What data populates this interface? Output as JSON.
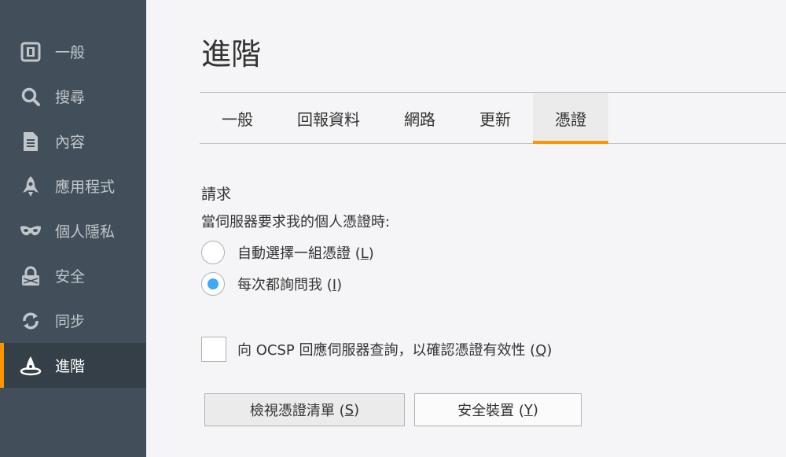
{
  "sidebar": {
    "items": [
      {
        "label": "一般",
        "icon": "general-icon"
      },
      {
        "label": "搜尋",
        "icon": "search-icon"
      },
      {
        "label": "內容",
        "icon": "document-icon"
      },
      {
        "label": "應用程式",
        "icon": "rocket-icon"
      },
      {
        "label": "個人隱私",
        "icon": "mask-icon"
      },
      {
        "label": "安全",
        "icon": "lock-icon"
      },
      {
        "label": "同步",
        "icon": "sync-icon"
      },
      {
        "label": "進階",
        "icon": "wizard-hat-icon"
      }
    ],
    "selected_index": 7
  },
  "page": {
    "title": "進階"
  },
  "tabs": [
    {
      "label": "一般"
    },
    {
      "label": "回報資料"
    },
    {
      "label": "網路"
    },
    {
      "label": "更新"
    },
    {
      "label": "憑證"
    }
  ],
  "selected_tab": 4,
  "requests": {
    "title": "請求",
    "description": "當伺服器要求我的個人憑證時:",
    "option_auto": {
      "label": "自動選擇一組憑證 (",
      "key": "L",
      "suffix": ")"
    },
    "option_ask": {
      "label": "每次都詢問我 (",
      "key": "I",
      "suffix": ")"
    },
    "selected_option": "ask"
  },
  "ocsp": {
    "label": "向 OCSP 回應伺服器查詢，以確認憑證有效性 (",
    "key": "Q",
    "suffix": ")",
    "checked": false
  },
  "buttons": {
    "view_certs": {
      "label": "檢視憑證清單 (",
      "key": "S",
      "suffix": ")"
    },
    "security_devices": {
      "label": "安全裝置 (",
      "key": "Y",
      "suffix": ")"
    }
  },
  "colors": {
    "sidebar_bg": "#424f5a",
    "sidebar_selected_bg": "#343f48",
    "accent": "#ff9500",
    "radio_selected": "#3fa9f5"
  }
}
